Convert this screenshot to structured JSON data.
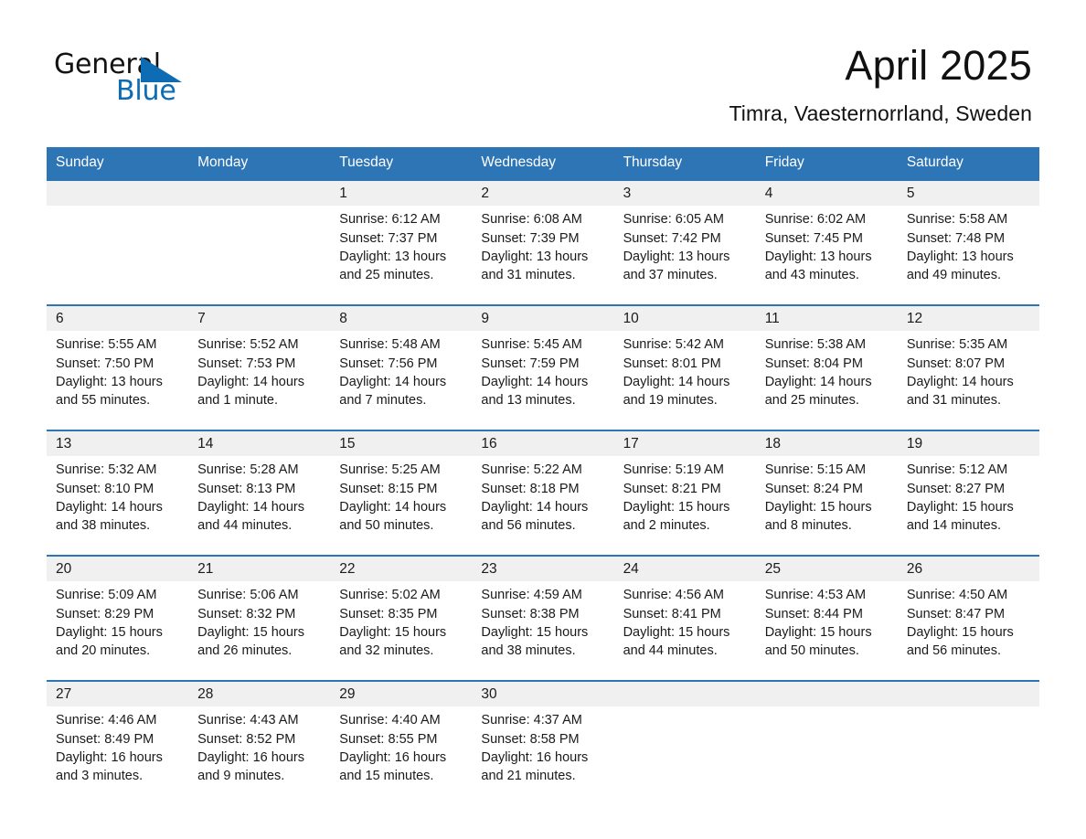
{
  "brand": {
    "name_part1": "General",
    "name_part2": "Blue",
    "accent_color": "#0d6cb3",
    "triangle_icon": "triangle-logo-icon"
  },
  "header": {
    "month_title": "April 2025",
    "location": "Timra, Vaesternorrland, Sweden"
  },
  "calendar": {
    "header_color": "#2e75b6",
    "daynum_band_color": "#f0f0f0",
    "weekdays": [
      "Sunday",
      "Monday",
      "Tuesday",
      "Wednesday",
      "Thursday",
      "Friday",
      "Saturday"
    ],
    "weeks": [
      [
        {
          "day": "",
          "lines": []
        },
        {
          "day": "",
          "lines": []
        },
        {
          "day": "1",
          "lines": [
            "Sunrise: 6:12 AM",
            "Sunset: 7:37 PM",
            "Daylight: 13 hours",
            "and 25 minutes."
          ]
        },
        {
          "day": "2",
          "lines": [
            "Sunrise: 6:08 AM",
            "Sunset: 7:39 PM",
            "Daylight: 13 hours",
            "and 31 minutes."
          ]
        },
        {
          "day": "3",
          "lines": [
            "Sunrise: 6:05 AM",
            "Sunset: 7:42 PM",
            "Daylight: 13 hours",
            "and 37 minutes."
          ]
        },
        {
          "day": "4",
          "lines": [
            "Sunrise: 6:02 AM",
            "Sunset: 7:45 PM",
            "Daylight: 13 hours",
            "and 43 minutes."
          ]
        },
        {
          "day": "5",
          "lines": [
            "Sunrise: 5:58 AM",
            "Sunset: 7:48 PM",
            "Daylight: 13 hours",
            "and 49 minutes."
          ]
        }
      ],
      [
        {
          "day": "6",
          "lines": [
            "Sunrise: 5:55 AM",
            "Sunset: 7:50 PM",
            "Daylight: 13 hours",
            "and 55 minutes."
          ]
        },
        {
          "day": "7",
          "lines": [
            "Sunrise: 5:52 AM",
            "Sunset: 7:53 PM",
            "Daylight: 14 hours",
            "and 1 minute."
          ]
        },
        {
          "day": "8",
          "lines": [
            "Sunrise: 5:48 AM",
            "Sunset: 7:56 PM",
            "Daylight: 14 hours",
            "and 7 minutes."
          ]
        },
        {
          "day": "9",
          "lines": [
            "Sunrise: 5:45 AM",
            "Sunset: 7:59 PM",
            "Daylight: 14 hours",
            "and 13 minutes."
          ]
        },
        {
          "day": "10",
          "lines": [
            "Sunrise: 5:42 AM",
            "Sunset: 8:01 PM",
            "Daylight: 14 hours",
            "and 19 minutes."
          ]
        },
        {
          "day": "11",
          "lines": [
            "Sunrise: 5:38 AM",
            "Sunset: 8:04 PM",
            "Daylight: 14 hours",
            "and 25 minutes."
          ]
        },
        {
          "day": "12",
          "lines": [
            "Sunrise: 5:35 AM",
            "Sunset: 8:07 PM",
            "Daylight: 14 hours",
            "and 31 minutes."
          ]
        }
      ],
      [
        {
          "day": "13",
          "lines": [
            "Sunrise: 5:32 AM",
            "Sunset: 8:10 PM",
            "Daylight: 14 hours",
            "and 38 minutes."
          ]
        },
        {
          "day": "14",
          "lines": [
            "Sunrise: 5:28 AM",
            "Sunset: 8:13 PM",
            "Daylight: 14 hours",
            "and 44 minutes."
          ]
        },
        {
          "day": "15",
          "lines": [
            "Sunrise: 5:25 AM",
            "Sunset: 8:15 PM",
            "Daylight: 14 hours",
            "and 50 minutes."
          ]
        },
        {
          "day": "16",
          "lines": [
            "Sunrise: 5:22 AM",
            "Sunset: 8:18 PM",
            "Daylight: 14 hours",
            "and 56 minutes."
          ]
        },
        {
          "day": "17",
          "lines": [
            "Sunrise: 5:19 AM",
            "Sunset: 8:21 PM",
            "Daylight: 15 hours",
            "and 2 minutes."
          ]
        },
        {
          "day": "18",
          "lines": [
            "Sunrise: 5:15 AM",
            "Sunset: 8:24 PM",
            "Daylight: 15 hours",
            "and 8 minutes."
          ]
        },
        {
          "day": "19",
          "lines": [
            "Sunrise: 5:12 AM",
            "Sunset: 8:27 PM",
            "Daylight: 15 hours",
            "and 14 minutes."
          ]
        }
      ],
      [
        {
          "day": "20",
          "lines": [
            "Sunrise: 5:09 AM",
            "Sunset: 8:29 PM",
            "Daylight: 15 hours",
            "and 20 minutes."
          ]
        },
        {
          "day": "21",
          "lines": [
            "Sunrise: 5:06 AM",
            "Sunset: 8:32 PM",
            "Daylight: 15 hours",
            "and 26 minutes."
          ]
        },
        {
          "day": "22",
          "lines": [
            "Sunrise: 5:02 AM",
            "Sunset: 8:35 PM",
            "Daylight: 15 hours",
            "and 32 minutes."
          ]
        },
        {
          "day": "23",
          "lines": [
            "Sunrise: 4:59 AM",
            "Sunset: 8:38 PM",
            "Daylight: 15 hours",
            "and 38 minutes."
          ]
        },
        {
          "day": "24",
          "lines": [
            "Sunrise: 4:56 AM",
            "Sunset: 8:41 PM",
            "Daylight: 15 hours",
            "and 44 minutes."
          ]
        },
        {
          "day": "25",
          "lines": [
            "Sunrise: 4:53 AM",
            "Sunset: 8:44 PM",
            "Daylight: 15 hours",
            "and 50 minutes."
          ]
        },
        {
          "day": "26",
          "lines": [
            "Sunrise: 4:50 AM",
            "Sunset: 8:47 PM",
            "Daylight: 15 hours",
            "and 56 minutes."
          ]
        }
      ],
      [
        {
          "day": "27",
          "lines": [
            "Sunrise: 4:46 AM",
            "Sunset: 8:49 PM",
            "Daylight: 16 hours",
            "and 3 minutes."
          ]
        },
        {
          "day": "28",
          "lines": [
            "Sunrise: 4:43 AM",
            "Sunset: 8:52 PM",
            "Daylight: 16 hours",
            "and 9 minutes."
          ]
        },
        {
          "day": "29",
          "lines": [
            "Sunrise: 4:40 AM",
            "Sunset: 8:55 PM",
            "Daylight: 16 hours",
            "and 15 minutes."
          ]
        },
        {
          "day": "30",
          "lines": [
            "Sunrise: 4:37 AM",
            "Sunset: 8:58 PM",
            "Daylight: 16 hours",
            "and 21 minutes."
          ]
        },
        {
          "day": "",
          "lines": []
        },
        {
          "day": "",
          "lines": []
        },
        {
          "day": "",
          "lines": []
        }
      ]
    ]
  }
}
